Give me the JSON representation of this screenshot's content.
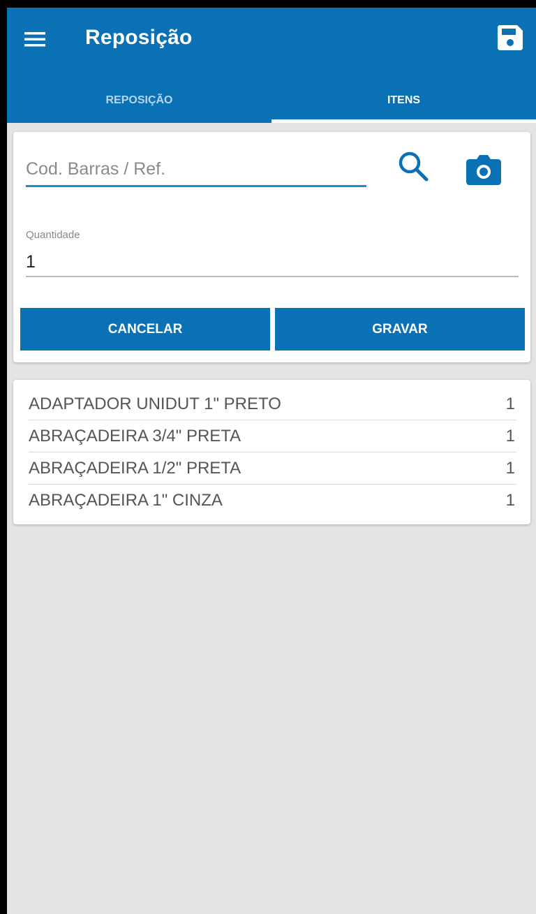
{
  "appbar": {
    "title": "Reposição",
    "menu_icon": "hamburger-menu-icon",
    "save_icon": "save-floppy-icon",
    "color": "#0a71b4"
  },
  "tabs": [
    {
      "label": "REPOSIÇÃO",
      "active": false
    },
    {
      "label": "ITENS",
      "active": true
    }
  ],
  "form": {
    "barcode": {
      "placeholder": "Cod. Barras / Ref.",
      "value": ""
    },
    "search_icon": "search-icon",
    "camera_icon": "camera-icon",
    "quantity": {
      "label": "Quantidade",
      "value": "1"
    },
    "buttons": {
      "cancel_label": "CANCELAR",
      "save_label": "GRAVAR"
    }
  },
  "items": [
    {
      "name": "ADAPTADOR UNIDUT 1\" PRETO",
      "qty": "1"
    },
    {
      "name": "ABRAÇADEIRA 3/4\" PRETA",
      "qty": "1"
    },
    {
      "name": "ABRAÇADEIRA 1/2\" PRETA",
      "qty": "1"
    },
    {
      "name": "ABRAÇADEIRA 1\" CINZA",
      "qty": "1"
    }
  ]
}
